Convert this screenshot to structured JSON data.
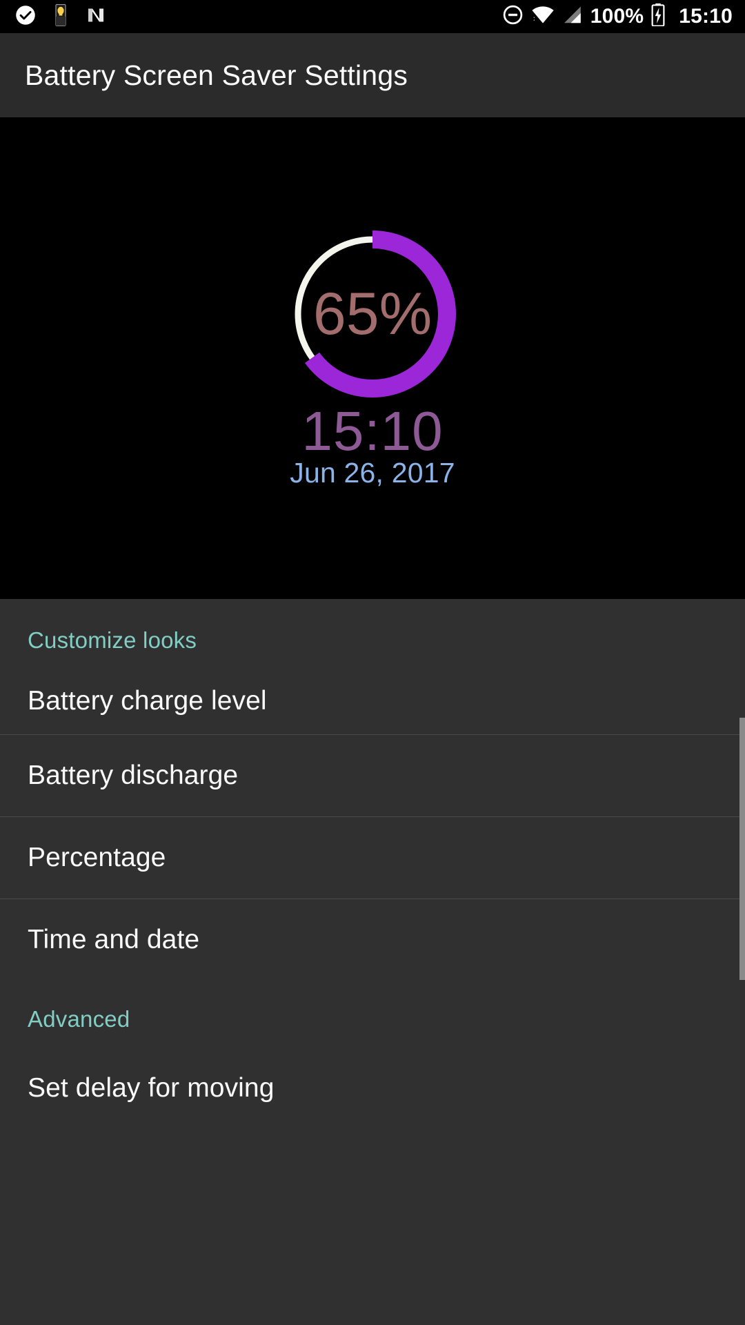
{
  "status_bar": {
    "left_icons": [
      {
        "name": "check-circle-icon",
        "label": "check-circle"
      },
      {
        "name": "flashlight-icon",
        "label": "flashlight"
      },
      {
        "name": "android-nougat-icon",
        "label": "android-n"
      }
    ],
    "right_icons": [
      {
        "name": "do-not-disturb-icon",
        "label": "do-not-disturb"
      },
      {
        "name": "wifi-icon",
        "label": "wifi"
      },
      {
        "name": "cellular-signal-icon",
        "label": "signal"
      }
    ],
    "battery_percent": "100%",
    "battery_icon": "battery-charging-icon",
    "clock": "15:10"
  },
  "title_bar": {
    "title": "Battery Screen Saver Settings"
  },
  "preview": {
    "battery_percent_value": 65,
    "battery_percent_text": "65%",
    "clock": "15:10",
    "date": "Jun 26, 2017",
    "colors": {
      "background": "#000000",
      "ring_track": "#f4f6ee",
      "ring_progress": "#9c27d8",
      "percent_text": "#a36d6d",
      "clock_text": "#8d5a96",
      "date_text": "#8ab3e8"
    }
  },
  "settings": {
    "sections": [
      {
        "header": "Customize looks",
        "items": [
          {
            "label": "Battery charge level"
          },
          {
            "label": "Battery discharge"
          },
          {
            "label": "Percentage"
          },
          {
            "label": "Time and date"
          }
        ]
      },
      {
        "header": "Advanced",
        "items": [
          {
            "label": "Set delay for moving"
          }
        ]
      }
    ],
    "colors": {
      "background": "#303030",
      "header_text": "#82cdc4",
      "item_text": "#fafafa",
      "divider": "#4a4a4a",
      "scrollbar": "#8a8a8a"
    }
  }
}
